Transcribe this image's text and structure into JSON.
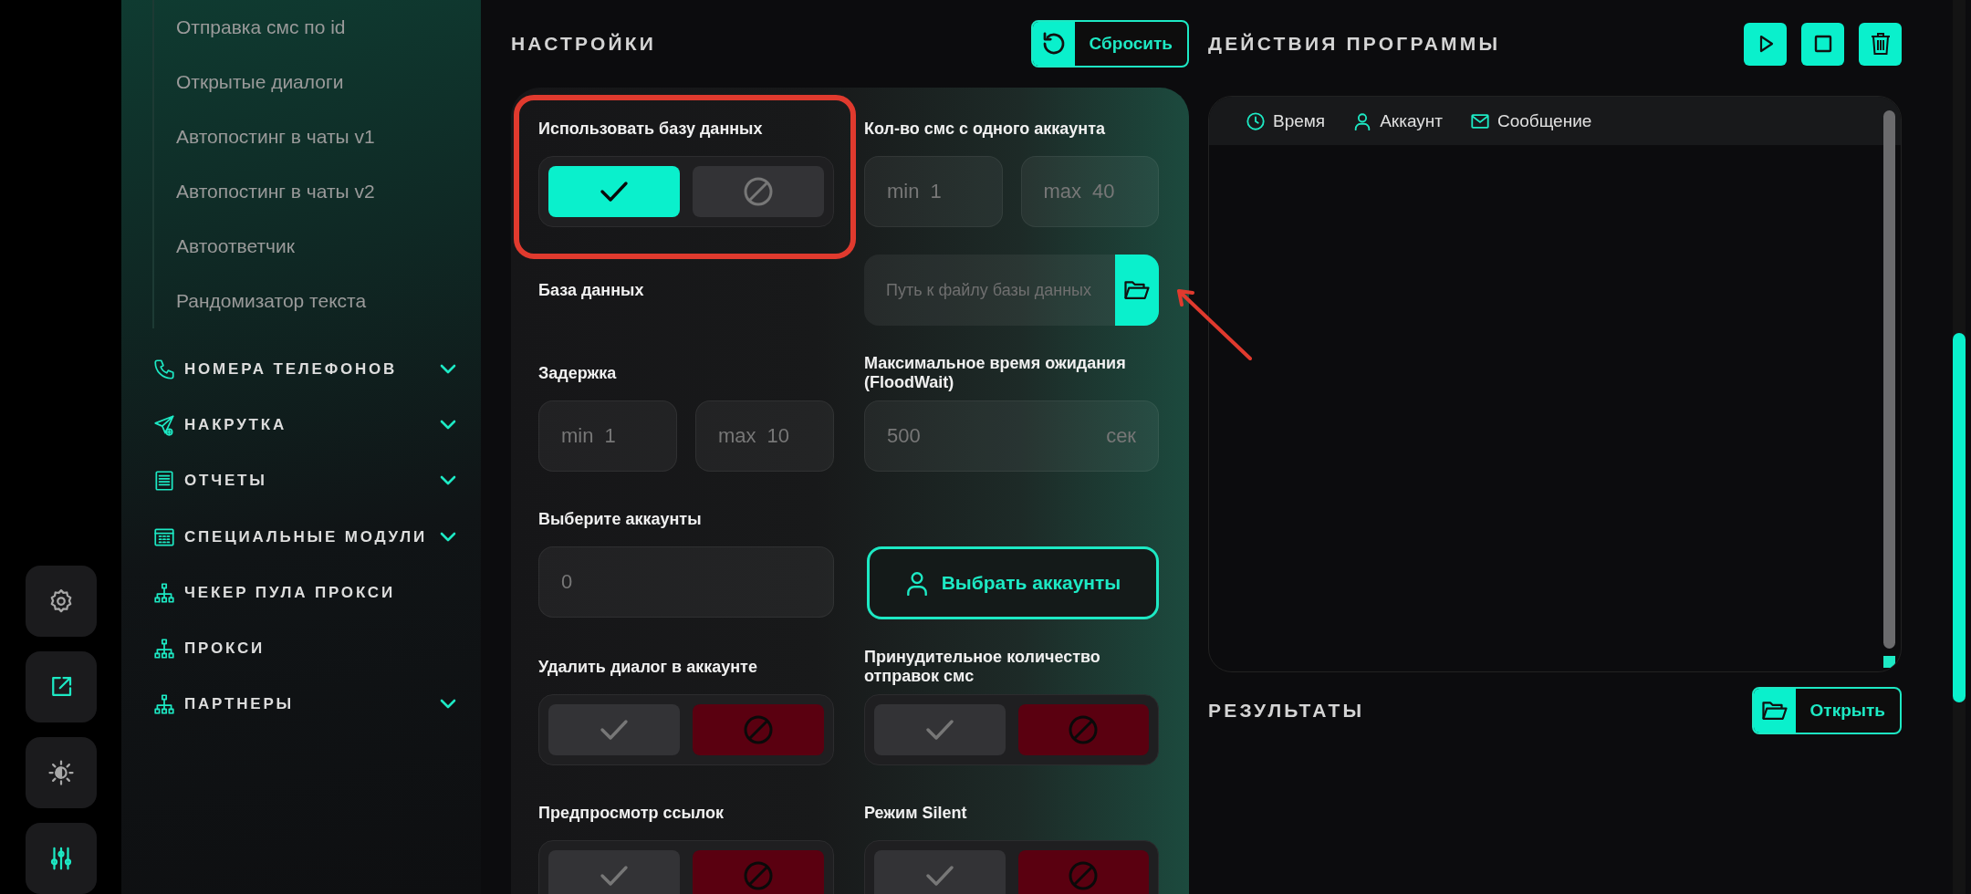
{
  "rail": [
    {
      "accent": false
    },
    {
      "accent": true
    },
    {
      "accent": false
    },
    {
      "accent": true
    }
  ],
  "sidebar": {
    "items": [
      "Отправка смс по id",
      "Открытые диалоги",
      "Автопостинг в чаты v1",
      "Автопостинг в чаты v2",
      "Автоответчик",
      "Рандомизатор текста"
    ],
    "sections": [
      {
        "label": "НОМЕРА ТЕЛЕФОНОВ",
        "expandable": true
      },
      {
        "label": "НАКРУТКА",
        "expandable": true
      },
      {
        "label": "ОТЧЕТЫ",
        "expandable": true
      },
      {
        "label": "СПЕЦИАЛЬНЫЕ МОДУЛИ",
        "expandable": true
      },
      {
        "label": "ЧЕКЕР ПУЛА ПРОКСИ",
        "expandable": false
      },
      {
        "label": "ПРОКСИ",
        "expandable": false
      },
      {
        "label": "ПАРТНЕРЫ",
        "expandable": true
      }
    ]
  },
  "settings": {
    "title": "НАСТРОЙКИ",
    "reset_button": "Сбросить",
    "fields": [
      {
        "kind": "toggle",
        "label": "Использовать базу данных",
        "checked": true,
        "framed": true,
        "pointed": false
      },
      {
        "kind": "range",
        "label": "Кол-во смс с одного аккаунта",
        "min_label": "min",
        "min": "1",
        "max_label": "max",
        "max": "40",
        "framed": false,
        "pointed": false
      },
      {
        "kind": "label",
        "label": "База данных",
        "framed": false,
        "pointed": false
      },
      {
        "kind": "file",
        "placeholder": "Путь к файлу базы данных",
        "framed": false,
        "pointed": true
      },
      {
        "kind": "range",
        "label": "Задержка",
        "min_label": "min",
        "min": "1",
        "max_label": "max",
        "max": "10",
        "framed": false,
        "pointed": false
      },
      {
        "kind": "unit",
        "label": "Максимальное время ожидания (FloodWait)",
        "value": "500",
        "unit": "сек",
        "framed": false,
        "pointed": false
      },
      {
        "kind": "number",
        "label": "Выберите аккаунты",
        "value": "0",
        "framed": false,
        "pointed": false
      },
      {
        "kind": "button",
        "label": "Выбрать аккаунты",
        "framed": false,
        "pointed": false
      },
      {
        "kind": "toggle",
        "label": "Удалить диалог в аккаунте",
        "checked": false,
        "framed": false,
        "pointed": false
      },
      {
        "kind": "toggle",
        "label": "Принудительное количество отправок смс",
        "checked": false,
        "framed": false,
        "pointed": false
      },
      {
        "kind": "toggle",
        "label": "Предпросмотр ссылок",
        "checked": false,
        "framed": false,
        "pointed": false
      },
      {
        "kind": "toggle",
        "label": "Режим Silent",
        "checked": false,
        "framed": false,
        "pointed": false
      }
    ]
  },
  "program_actions": {
    "title": "ДЕЙСТВИЯ ПРОГРАММЫ",
    "log_columns": [
      "Время",
      "Аккаунт",
      "Сообщение"
    ]
  },
  "results": {
    "title": "РЕЗУЛЬТАТЫ",
    "open_button": "Открыть"
  }
}
